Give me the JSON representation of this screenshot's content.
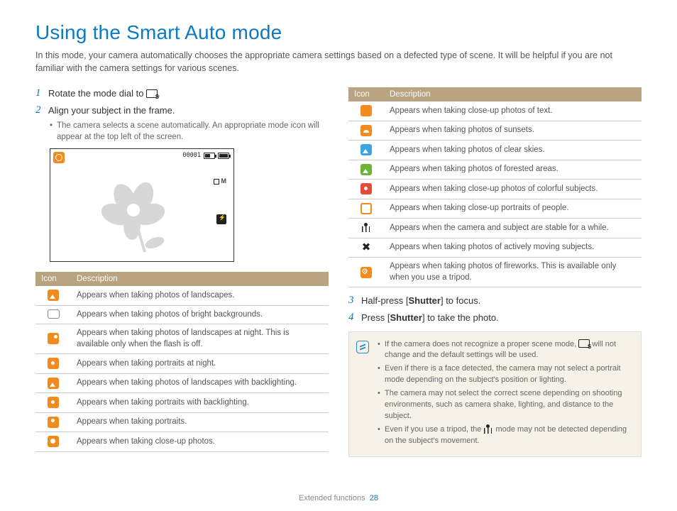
{
  "title": "Using the Smart Auto mode",
  "intro": "In this mode, your camera automatically chooses the appropriate camera settings based on a defected type of scene. It will be helpful if you are not familiar with the camera settings for various scenes.",
  "steps": {
    "s1_num": "1",
    "s1_pre": "Rotate the mode dial to ",
    "s1_post": ".",
    "s2_num": "2",
    "s2_text": "Align your subject in the frame.",
    "s2_bullet": "The camera selects a scene automatically. An appropriate mode icon will appear at the top left of the screen.",
    "s3_num": "3",
    "s3_pre": "Half-press [",
    "s3_bold": "Shutter",
    "s3_post": "] to focus.",
    "s4_num": "4",
    "s4_pre": "Press [",
    "s4_bold": "Shutter",
    "s4_post": "] to take the photo."
  },
  "preview": {
    "counter": "00001",
    "mode_label": "M"
  },
  "table_headers": {
    "icon": "Icon",
    "desc": "Description"
  },
  "table1": [
    {
      "icon": "landscape",
      "desc": "Appears when taking photos of landscapes."
    },
    {
      "icon": "bright-bg",
      "desc": "Appears when taking photos of bright backgrounds."
    },
    {
      "icon": "night-land",
      "desc": "Appears when taking photos of landscapes at night. This is available only when the flash is off."
    },
    {
      "icon": "night-portrait",
      "desc": "Appears when taking portraits at night."
    },
    {
      "icon": "backlight-land",
      "desc": "Appears when taking photos of landscapes with backlighting."
    },
    {
      "icon": "backlight-portrait",
      "desc": "Appears when taking portraits with backlighting."
    },
    {
      "icon": "portrait",
      "desc": "Appears when taking portraits."
    },
    {
      "icon": "closeup",
      "desc": "Appears when taking close-up photos."
    }
  ],
  "table2": [
    {
      "icon": "closeup-text",
      "desc": "Appears when taking close-up photos of text."
    },
    {
      "icon": "sunset",
      "desc": "Appears when taking photos of sunsets."
    },
    {
      "icon": "sky",
      "desc": "Appears when taking photos of clear skies."
    },
    {
      "icon": "forest",
      "desc": "Appears when taking photos of forested areas."
    },
    {
      "icon": "colorful",
      "desc": "Appears when taking close-up photos of colorful subjects."
    },
    {
      "icon": "closeup-portrait",
      "desc": "Appears when taking close-up portraits of people."
    },
    {
      "icon": "tripod",
      "desc": "Appears when the camera and subject are stable for a while."
    },
    {
      "icon": "action",
      "desc": "Appears when taking photos of actively moving subjects."
    },
    {
      "icon": "fireworks",
      "desc": "Appears when taking photos of fireworks. This is available only when you use a tripod."
    }
  ],
  "notes": {
    "n1a": "If the camera does not recognize a proper scene mode, ",
    "n1b": " will not change and the default settings will be used.",
    "n2": "Even if there is a face detected, the camera may not select a portrait mode depending on the subject's position or lighting.",
    "n3": "The camera may not select the correct scene depending on shooting environments, such as camera shake, lighting, and distance to the subject.",
    "n4a": "Even if you use a tripod, the ",
    "n4b": " mode may not be detected depending on the subject's movement."
  },
  "footer": {
    "section": "Extended functions",
    "page": "28"
  }
}
